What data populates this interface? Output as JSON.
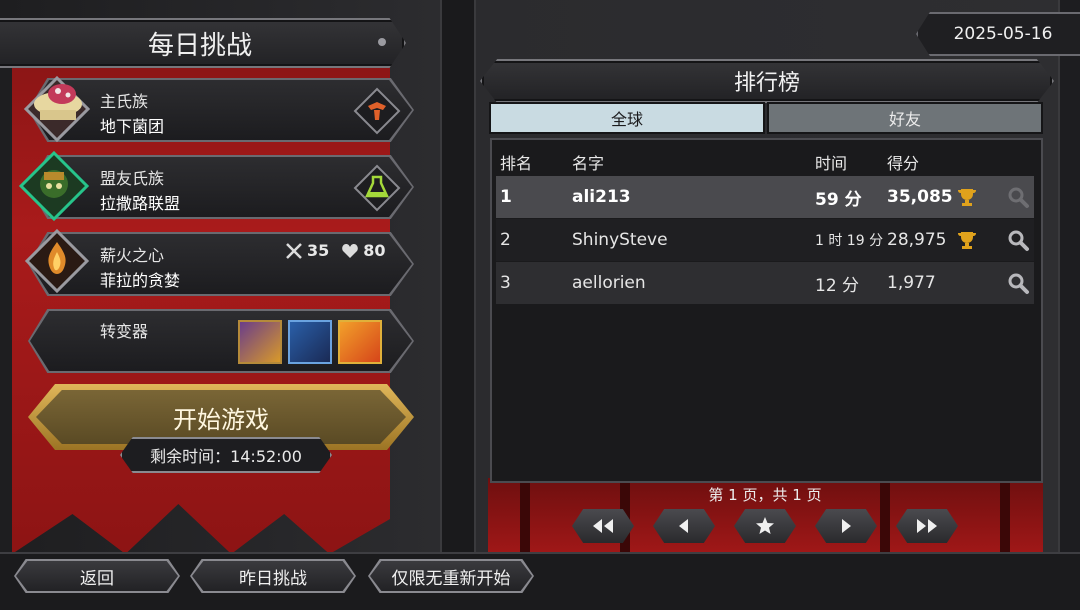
{
  "left_panel": {
    "title": "每日挑战",
    "main_clan": {
      "label": "主氏族",
      "value": "地下菌团"
    },
    "ally_clan": {
      "label": "盟友氏族",
      "value": "拉撒路联盟"
    },
    "pyre": {
      "label": "薪火之心",
      "value": "菲拉的贪婪",
      "attack": "35",
      "health": "80"
    },
    "mutator": {
      "label": "转变器"
    },
    "start_button": "开始游戏",
    "timer": "剩余时间：14:52:00"
  },
  "date": "2025-05-16",
  "leaderboard": {
    "title": "排行榜",
    "tabs": [
      "全球",
      "好友"
    ],
    "active_tab": "全球",
    "columns": [
      "排名",
      "名字",
      "时间",
      "得分"
    ],
    "rows": [
      {
        "rank": "1",
        "name": "ali213",
        "time": "59 分",
        "score": "35,085",
        "trophy": true,
        "highlight": true
      },
      {
        "rank": "2",
        "name": "ShinySteve",
        "time": "1 时 19 分",
        "score": "28,975",
        "trophy": true,
        "highlight": false
      },
      {
        "rank": "3",
        "name": "aellorien",
        "time": "12 分",
        "score": "1,977",
        "trophy": false,
        "highlight": false
      }
    ],
    "page_text": "第 1 页，共 1 页"
  },
  "bottom_bar": {
    "back": "返回",
    "yesterday": "昨日挑战",
    "no_restart": "仅限无重新开始"
  },
  "colors": {
    "banner_red": "#a91b1b",
    "gold": "#e0b75a",
    "trophy": "#e0a21c",
    "tab_active": "#c9dbe2"
  }
}
